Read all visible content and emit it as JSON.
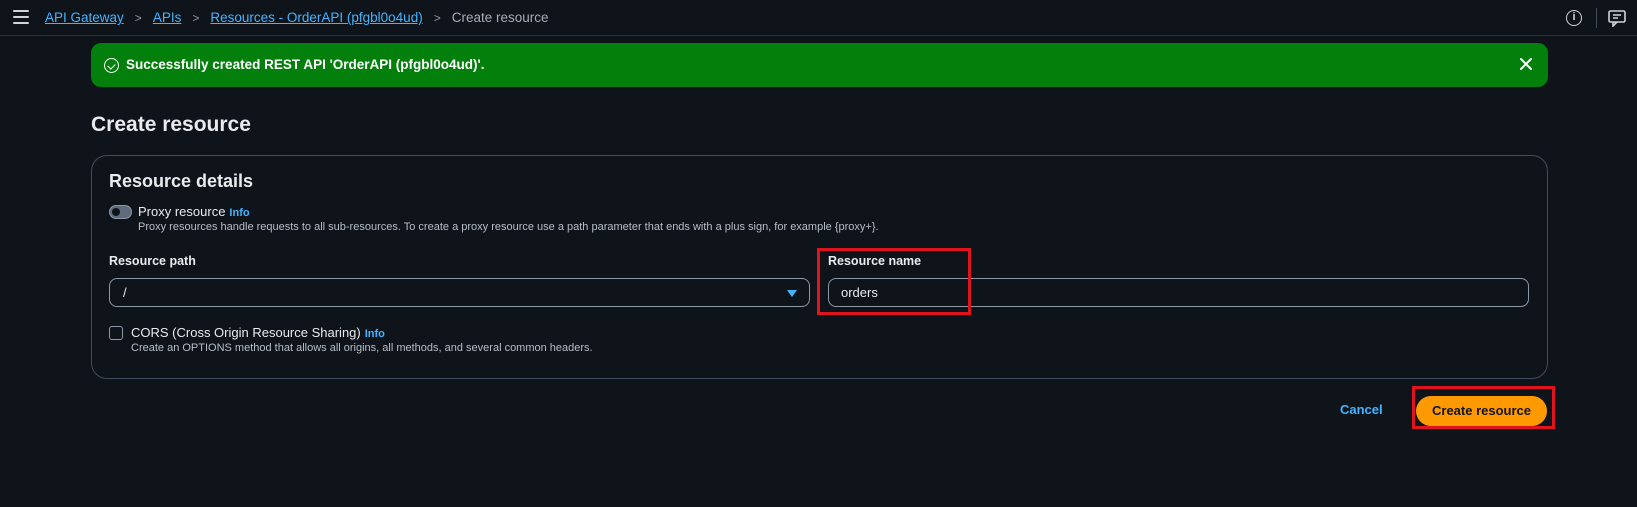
{
  "breadcrumb": {
    "items": [
      "API Gateway",
      "APIs",
      "Resources - OrderAPI (pfgbl0o4ud)"
    ],
    "current": "Create resource",
    "separator": ">"
  },
  "top_icons": [
    "info-icon",
    "feedback-icon"
  ],
  "flash": {
    "message": "Successfully created REST API 'OrderAPI (pfgbl0o4ud)'.",
    "color": "#037f0c",
    "icon": "success-check-icon"
  },
  "page": {
    "title": "Create resource"
  },
  "form": {
    "section_title": "Resource details",
    "proxy": {
      "label": "Proxy resource",
      "info": "Info",
      "description": "Proxy resources handle requests to all sub-resources. To create a proxy resource use a path parameter that ends with a plus sign, for example {proxy+}.",
      "enabled": false
    },
    "resource_path": {
      "label": "Resource path",
      "value": "/"
    },
    "resource_name": {
      "label": "Resource name",
      "value": "orders"
    },
    "cors": {
      "label": "CORS (Cross Origin Resource Sharing)",
      "info": "Info",
      "description": "Create an OPTIONS method that allows all origins, all methods, and several common headers.",
      "checked": false
    }
  },
  "actions": {
    "cancel": "Cancel",
    "create": "Create resource"
  },
  "colors": {
    "background": "#0f141a",
    "link": "#42b4ff",
    "primary_button": "#ff9900",
    "highlight": "#e0141e"
  }
}
